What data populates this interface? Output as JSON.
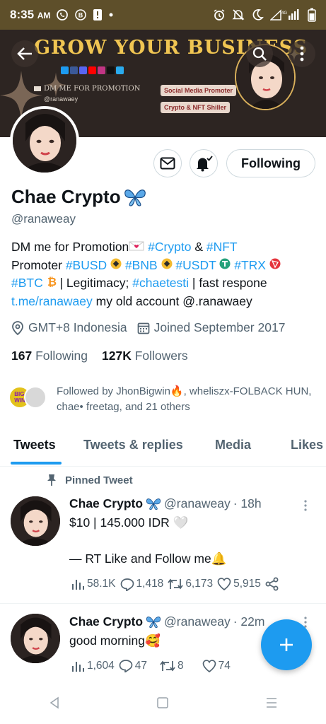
{
  "status": {
    "time": "8:35",
    "ampm": "AM",
    "net": "4G LTE"
  },
  "banner": {
    "title": "GROW YOUR BUSINESS",
    "promo": "DM ME FOR PROMOTION",
    "handle": "@ranawaey",
    "tag1": "Social Media Promoter",
    "tag2": "Crypto & NFT Shiller"
  },
  "profile": {
    "name": "Chae Crypto",
    "handle": "@ranaweay",
    "following_button": "Following",
    "bio": {
      "l1_a": "DM me for Promotion",
      "l1_b": "#Crypto",
      "l1_c": " & ",
      "l1_d": "#NFT",
      "l2_a": "Promoter ",
      "l2_b": "#BUSD",
      "l2_c": "#BNB",
      "l2_d": "#USDT",
      "l2_e": "#TRX",
      "l3_a": "#BTC",
      "l3_b": " | Legitimacy; ",
      "l3_c": "#chaetesti",
      "l3_d": " | fast respone",
      "l4_a": "t.me/ranawaey",
      "l4_b": " my old account @.ranawaey"
    },
    "location": "GMT+8 Indonesia",
    "joined": "Joined September 2017",
    "following_count": "167",
    "following_label": "Following",
    "followers_count": "127K",
    "followers_label": "Followers",
    "followed_by": "Followed by JhonBigwin🔥, wheliszx-FOLBACK HUN, chae• freetag, and 21 others"
  },
  "tabs": [
    "Tweets",
    "Tweets & replies",
    "Media",
    "Likes"
  ],
  "pinned_label": "Pinned Tweet",
  "tweets": [
    {
      "name": "Chae Crypto",
      "handle": "@ranaweay",
      "time": "· 18h",
      "line1": "$10 | 145.000 IDR 🤍",
      "line2": "— RT Like and Follow me🔔",
      "views": "58.1K",
      "replies": "1,418",
      "retweets": "6,173",
      "likes": "5,915"
    },
    {
      "name": "Chae Crypto",
      "handle": "@ranaweay",
      "time": "· 22m",
      "line1": "good morning🥰",
      "views": "1,604",
      "replies": "47",
      "retweets": "8",
      "likes": "74"
    }
  ],
  "colors": {
    "accent": "#1d9bf0",
    "banner_bg": "#2d2522",
    "banner_gold": "#f0c552",
    "statusbar": "#5e4f2a"
  }
}
